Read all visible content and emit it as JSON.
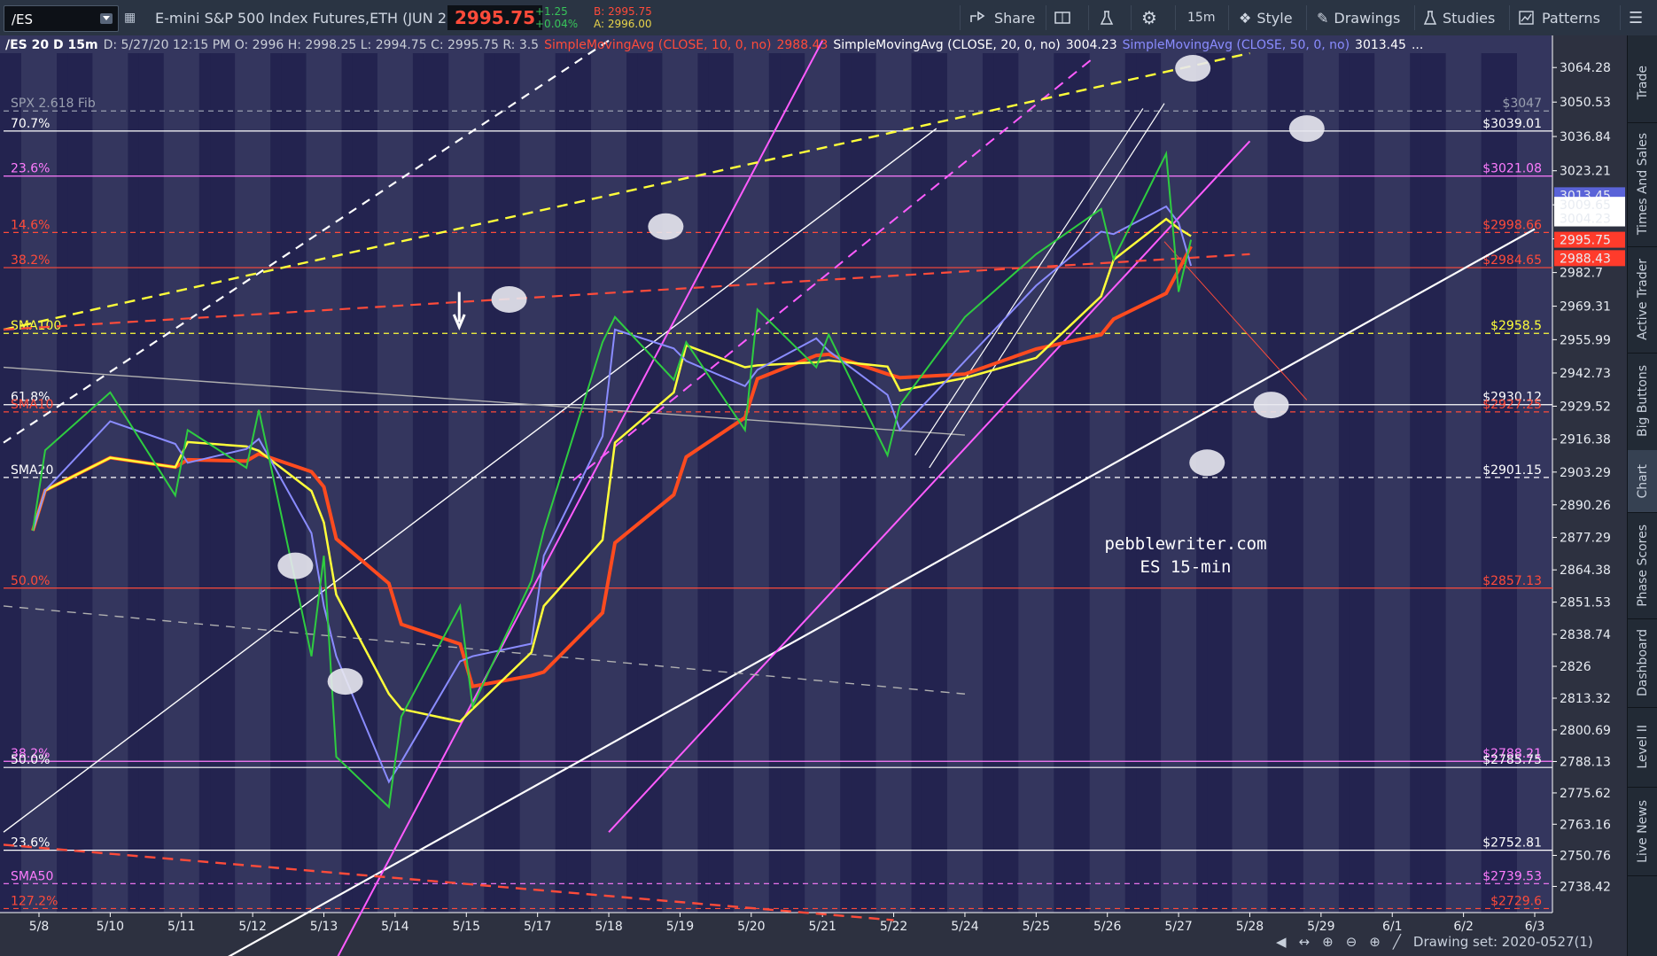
{
  "toolbar": {
    "symbol": "/ES",
    "description": "E-mini S&P 500 Index Futures,ETH (JUN 20)",
    "last": "2995.75",
    "change": "+1.25",
    "change_pct": "+0.04%",
    "bid": "B: 2995.75",
    "ask": "A: 2996.00",
    "share": "Share",
    "timeframe": "15m",
    "style": "Style",
    "drawings": "Drawings",
    "studies": "Studies",
    "patterns": "Patterns"
  },
  "legend": {
    "symbol": "/ES 20 D 15m",
    "meta": "D: 5/27/20 12:15 PM  O: 2996  H: 2998.25  L: 2994.75  C: 2995.75  R: 3.5",
    "sma10_name": "SimpleMovingAvg (CLOSE, 10, 0, no)",
    "sma10_val": "2988.43",
    "sma20_name": "SimpleMovingAvg (CLOSE, 20, 0, no)",
    "sma20_val": "3004.23",
    "sma50_name": "SimpleMovingAvg (CLOSE, 50, 0, no)",
    "sma50_val": "3013.45",
    "more": "..."
  },
  "side_tabs": [
    "Trade",
    "Times And Sales",
    "Active Trader",
    "Big Buttons",
    "Chart",
    "Phase Scores",
    "Dashboard",
    "Level II",
    "Live News"
  ],
  "side_active": "Chart",
  "watermark": [
    "pebblewriter.com",
    "ES 15-min"
  ],
  "drawing_set": "Drawing set: 2020-0527(1)",
  "colors": {
    "bg": "#34365e",
    "stripe": "#23234f",
    "price": "#2ecc40",
    "sma10": "#ff4b1f",
    "sma20": "#ffff3a",
    "sma50": "#8a8cff",
    "magenta": "#ff5cff",
    "fib_red": "#ff4b3a",
    "white": "#ffffff"
  },
  "chart_data": {
    "type": "line",
    "title": "",
    "y_range": [
      2728,
      3070
    ],
    "y_ticks": [
      "3064.28",
      "3050.53",
      "3036.84",
      "3023.21",
      "3009.65",
      "2996.11",
      "2982.7",
      "2969.31",
      "2955.99",
      "2942.73",
      "2929.52",
      "2916.38",
      "2903.29",
      "2890.26",
      "2877.29",
      "2864.38",
      "2851.53",
      "2838.74",
      "2826",
      "2813.32",
      "2800.69",
      "2788.13",
      "2775.62",
      "2763.16",
      "2750.76",
      "2738.42"
    ],
    "x_labels": [
      "5/8",
      "5/10",
      "5/11",
      "5/12",
      "5/13",
      "5/14",
      "5/15",
      "5/17",
      "5/18",
      "5/19",
      "5/20",
      "5/21",
      "5/22",
      "5/24",
      "5/25",
      "5/26",
      "5/27",
      "5/28",
      "5/29",
      "6/1",
      "6/2",
      "6/3"
    ],
    "price_path": [
      {
        "x": "5/8",
        "y": 2880
      },
      {
        "x": "5/8",
        "y": 2912
      },
      {
        "x": "5/10",
        "y": 2935
      },
      {
        "x": "5/11",
        "y": 2894
      },
      {
        "x": "5/11",
        "y": 2920
      },
      {
        "x": "5/12",
        "y": 2905
      },
      {
        "x": "5/12",
        "y": 2928
      },
      {
        "x": "5/13",
        "y": 2830
      },
      {
        "x": "5/13",
        "y": 2870
      },
      {
        "x": "5/13",
        "y": 2790
      },
      {
        "x": "5/14",
        "y": 2770
      },
      {
        "x": "5/14",
        "y": 2806
      },
      {
        "x": "5/15",
        "y": 2850
      },
      {
        "x": "5/15",
        "y": 2810
      },
      {
        "x": "5/17",
        "y": 2860
      },
      {
        "x": "5/17",
        "y": 2880
      },
      {
        "x": "5/18",
        "y": 2955
      },
      {
        "x": "5/18",
        "y": 2965
      },
      {
        "x": "5/19",
        "y": 2940
      },
      {
        "x": "5/19",
        "y": 2955
      },
      {
        "x": "5/20",
        "y": 2920
      },
      {
        "x": "5/20",
        "y": 2968
      },
      {
        "x": "5/21",
        "y": 2945
      },
      {
        "x": "5/21",
        "y": 2958
      },
      {
        "x": "5/22",
        "y": 2910
      },
      {
        "x": "5/22",
        "y": 2930
      },
      {
        "x": "5/24",
        "y": 2965
      },
      {
        "x": "5/25",
        "y": 2990
      },
      {
        "x": "5/26",
        "y": 3008
      },
      {
        "x": "5/26",
        "y": 2988
      },
      {
        "x": "5/27",
        "y": 3030
      },
      {
        "x": "5/27",
        "y": 2975
      },
      {
        "x": "5/27",
        "y": 2995.75
      }
    ],
    "series": [
      {
        "name": "SMA10",
        "last": 2988.43
      },
      {
        "name": "SMA20",
        "last": 3004.23
      },
      {
        "name": "SMA50",
        "last": 3013.45
      }
    ],
    "price_marks": [
      {
        "label": "3013.45",
        "y": 3013.45,
        "color": "#5a63d8"
      },
      {
        "label": "3009.65",
        "y": 3009.65,
        "color": "#ffffff"
      },
      {
        "label": "3004.23",
        "y": 3004.23,
        "color": "#ffffff"
      },
      {
        "label": "2995.75",
        "y": 2995.75,
        "color": "#ff3b2b"
      },
      {
        "label": "2988.43",
        "y": 2988.43,
        "color": "#ff3b2b"
      }
    ],
    "levels": [
      {
        "left": "SPX 2.618 Fib",
        "right": "$3047",
        "y": 3047,
        "color": "#9aa0b0",
        "dash": true
      },
      {
        "left": "70.7%",
        "right": "$3039.01",
        "y": 3039.01,
        "color": "#ffffff",
        "dash": false
      },
      {
        "left": "23.6%",
        "right": "$3021.08",
        "y": 3021.08,
        "color": "#ff7cff",
        "dash": false
      },
      {
        "left": "14.6%",
        "right": "$2998.66",
        "y": 2998.66,
        "color": "#ff4b3a",
        "dash": true
      },
      {
        "left": "38.2%",
        "right": "$2984.65",
        "y": 2984.65,
        "color": "#ff4b3a",
        "dash": false
      },
      {
        "left": "SMA100",
        "right": "$2958.5",
        "y": 2958.5,
        "color": "#ffff3a",
        "dash": true
      },
      {
        "left": "61.8%",
        "right": "$2930.12",
        "y": 2930.12,
        "color": "#ffffff",
        "dash": false
      },
      {
        "left": "SMA10",
        "right": "$2927.25",
        "y": 2927.25,
        "color": "#ff4b3a",
        "dash": true
      },
      {
        "left": "SMA20",
        "right": "$2901.15",
        "y": 2901.15,
        "color": "#ffffff",
        "dash": true
      },
      {
        "left": "50.0%",
        "right": "$2857.13",
        "y": 2857.13,
        "color": "#ff4b3a",
        "dash": false
      },
      {
        "left": "38.2%",
        "right": "$2788.21",
        "y": 2788.21,
        "color": "#ff7cff",
        "dash": false
      },
      {
        "left": "50.0%",
        "right": "$2785.75",
        "y": 2785.75,
        "color": "#ffffff",
        "dash": false
      },
      {
        "left": "23.6%",
        "right": "$2752.81",
        "y": 2752.81,
        "color": "#ffffff",
        "dash": false
      },
      {
        "left": "SMA50",
        "right": "$2739.53",
        "y": 2739.53,
        "color": "#ff7cff",
        "dash": true
      },
      {
        "left": "127.2%",
        "right": "$2729.6",
        "y": 2729.6,
        "color": "#ff4b3a",
        "dash": true
      }
    ]
  }
}
